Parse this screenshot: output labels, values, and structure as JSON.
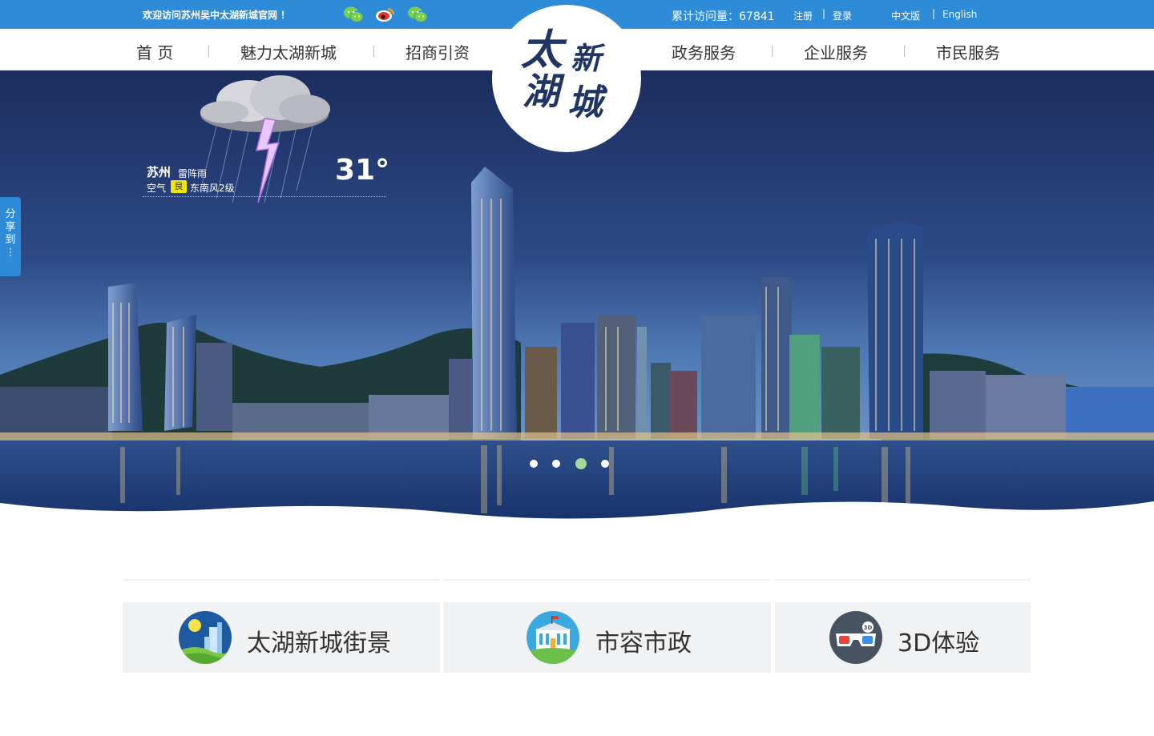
{
  "topbar": {
    "welcome": "欢迎访问苏州吴中太湖新城官网 ！",
    "visits": "累计访问量：67841",
    "register": "注册",
    "login": "登录",
    "lang_cn": "中文版",
    "lang_en": "English",
    "sep": "|",
    "social_icons": [
      "wechat-icon",
      "weibo-icon",
      "wechat-icon"
    ]
  },
  "nav": {
    "items": [
      "首 页",
      "魅力太湖新城",
      "招商引资",
      "政务服务",
      "企业服务",
      "市民服务"
    ],
    "divider": "|"
  },
  "logo": {
    "chars": [
      "太",
      "新",
      "湖",
      "城"
    ]
  },
  "weather": {
    "city": "苏州",
    "condition": "雷阵雨",
    "air_label": "空气",
    "air_quality": "良",
    "wind": "东南风2级",
    "temperature": "31°"
  },
  "share": {
    "label": "分享到：：",
    "chars": [
      "分",
      "享",
      "到",
      "⋮"
    ]
  },
  "slider": {
    "count": 4,
    "active_index": 2
  },
  "cards": [
    {
      "label": "太湖新城街景",
      "icon": "street-view-icon"
    },
    {
      "label": "市容市政",
      "icon": "city-hall-icon"
    },
    {
      "label": "3D体验",
      "icon": "3d-glasses-icon"
    }
  ],
  "colors": {
    "brand_blue": "#2e8bd8",
    "active_dot": "#a6d89a",
    "card_bg": "#f1f2f4",
    "logo_text": "#1f3564"
  }
}
